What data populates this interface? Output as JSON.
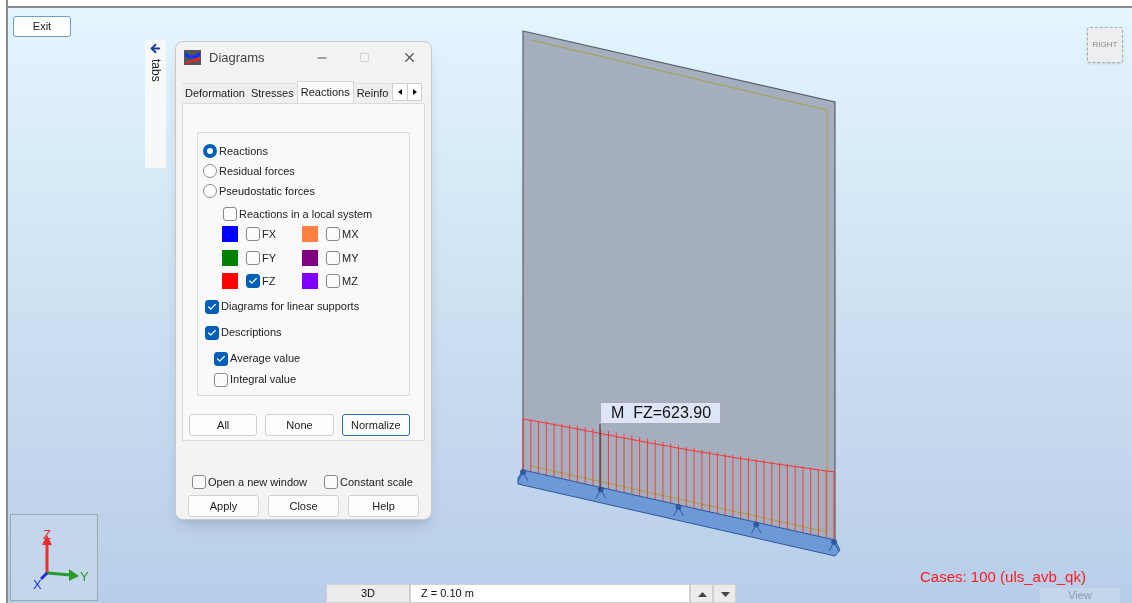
{
  "exit_button": "Exit",
  "side_panel": {
    "label": "tabs"
  },
  "dialog": {
    "title": "Diagrams",
    "tabs": [
      {
        "label": "Deformation",
        "selected": false
      },
      {
        "label": "Stresses",
        "selected": false
      },
      {
        "label": "Reactions",
        "selected": true
      },
      {
        "label": "Reinfo",
        "selected": false
      }
    ],
    "radios": [
      {
        "label": "Reactions",
        "selected": true
      },
      {
        "label": "Residual forces",
        "selected": false
      },
      {
        "label": "Pseudostatic forces",
        "selected": false
      }
    ],
    "local_system": {
      "label": "Reactions in a local system",
      "checked": false
    },
    "components": [
      {
        "label": "FX",
        "color": "#0000ff",
        "checked": false
      },
      {
        "label": "MX",
        "color": "#ff8040",
        "checked": false
      },
      {
        "label": "FY",
        "color": "#008000",
        "checked": false
      },
      {
        "label": "MY",
        "color": "#800080",
        "checked": false
      },
      {
        "label": "FZ",
        "color": "#ff0000",
        "checked": true
      },
      {
        "label": "MZ",
        "color": "#8000ff",
        "checked": false
      }
    ],
    "options": [
      {
        "label": "Diagrams for linear supports",
        "checked": true
      },
      {
        "label": "Descriptions",
        "checked": true,
        "children": [
          {
            "label": "Average value",
            "checked": true
          },
          {
            "label": "Integral value",
            "checked": false
          }
        ]
      }
    ],
    "panel_buttons": [
      {
        "label": "All",
        "focused": false
      },
      {
        "label": "None",
        "focused": false
      },
      {
        "label": "Normalize",
        "focused": true
      }
    ],
    "footer_checks": [
      {
        "label": "Open a new window",
        "checked": false
      },
      {
        "label": "Constant scale",
        "checked": false
      }
    ],
    "footer_buttons": [
      "Apply",
      "Close",
      "Help"
    ]
  },
  "viewport": {
    "annotation": "M  FZ=623.90",
    "view_cube": "RIGHT",
    "cases": "Cases: 100 (uls_avb_qk)",
    "axes": {
      "z": "Z",
      "y": "Y",
      "x": "X"
    }
  },
  "bottom_bar": {
    "view_button": "3D",
    "level_field": "Z = 0.10 m",
    "view_label": "View"
  }
}
